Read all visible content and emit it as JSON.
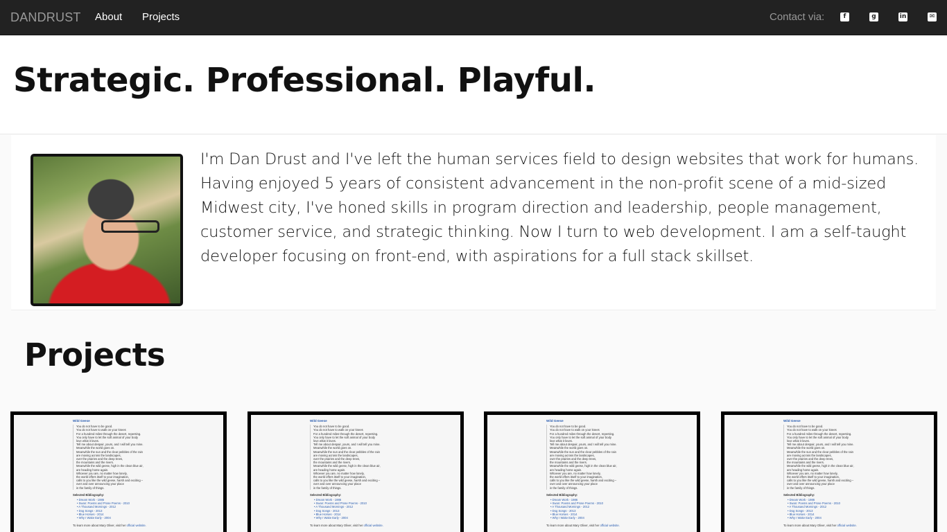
{
  "nav": {
    "brand": "DANDRUST",
    "links": [
      "About",
      "Projects"
    ],
    "contact_label": "Contact via:",
    "social_icons": [
      "facebook-icon",
      "github-icon",
      "linkedin-icon",
      "email-icon"
    ],
    "social_glyphs": [
      "f",
      "g",
      "in",
      "✉"
    ]
  },
  "hero": {
    "title": "Strategic. Professional. Playful."
  },
  "about": {
    "text": "I'm Dan Drust and I've left the human services field to design websites that work for humans. Having enjoyed 5 years of consistent advancement in the non-profit scene of a mid-sized Midwest city, I've honed skills in program direction and leadership, people management, customer service, and strategic thinking. Now I turn to web development. I am a self-taught developer focusing on front-end, with aspirations for a full stack skillset."
  },
  "projects": {
    "heading": "Projects",
    "thumbnail": {
      "title": "Wild Geese",
      "poem": [
        "You do not have to be good.",
        "You do not have to walk on your knees",
        "For a hundred miles through the desert, repenting.",
        "You only have to let the soft animal of your body",
        "love what it loves.",
        "Tell me about despair, yours, and I will tell you mine.",
        "Meanwhile the world goes on.",
        "Meanwhile the sun and the clear pebbles of the rain",
        "are moving across the landscapes,",
        "over the prairies and the deep trees,",
        "the mountains and the rivers.",
        "Meanwhile the wild geese, high in the clean blue air,",
        "are heading home again.",
        "Whoever you are, no matter how lonely,",
        "the world offers itself to your imagination,",
        "calls to you like the wild geese, harsh and exciting –",
        "over and over announcing your place",
        "in the family of things."
      ],
      "bibliography_label": "Selected Bibliography:",
      "bibliography": [
        "Dream Work - 1986",
        "Swan: Poems and Prose Poems - 2010",
        "A Thousand Mornings - 2012",
        "Dog Songs - 2013",
        "Blue Horses - 2014",
        "Why I Wake Early - 2004"
      ],
      "more_text": "To learn more about Mary Oliver, visit her",
      "more_link": "official website."
    }
  }
}
